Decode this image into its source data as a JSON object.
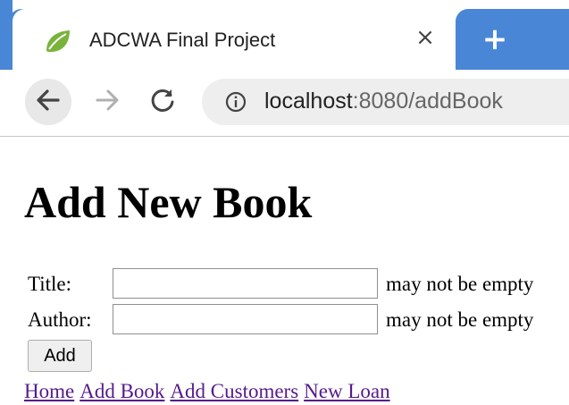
{
  "browser": {
    "tab_title": "ADCWA Final Project",
    "tab_close_glyph": "×",
    "new_tab_glyph": "+",
    "url_host": "localhost",
    "url_rest": ":8080/addBook",
    "icons": {
      "favicon": "leaf-icon",
      "back": "back-arrow-icon",
      "forward": "forward-arrow-icon",
      "reload": "reload-icon",
      "info": "info-icon"
    },
    "colors": {
      "accent": "#4a86d6",
      "favicon": "#7ab33c"
    }
  },
  "page": {
    "title": "Add New Book",
    "form": {
      "title_label": "Title:",
      "title_value": "",
      "title_error": "may not be empty",
      "author_label": "Author:",
      "author_value": "",
      "author_error": "may not be empty",
      "submit_label": "Add"
    },
    "nav_links": [
      "Home",
      "Add Book",
      "Add Customers",
      "New Loan"
    ],
    "colors": {
      "link": "#551a8b"
    }
  }
}
